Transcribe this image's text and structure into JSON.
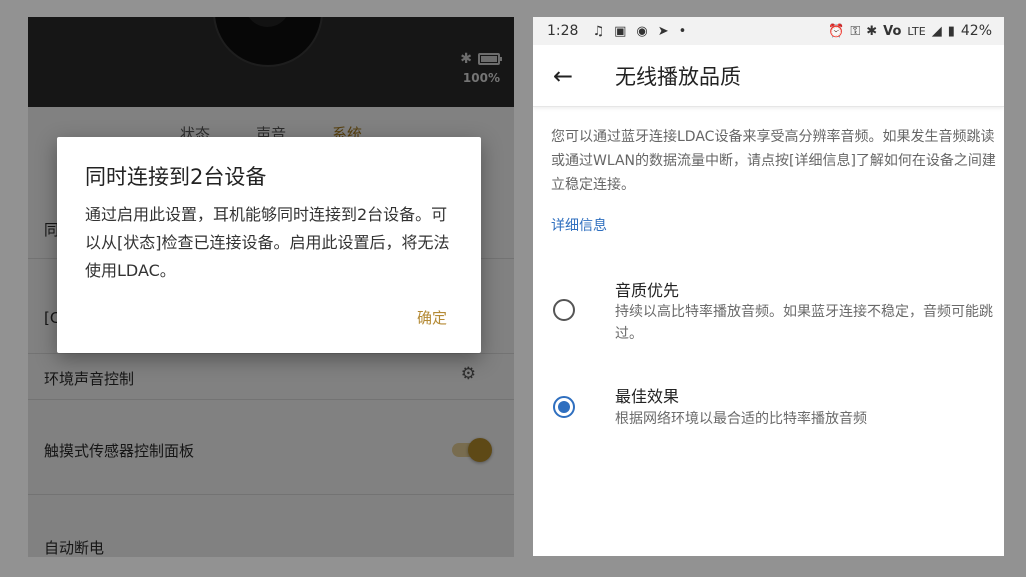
{
  "left": {
    "battery_percent": "100%",
    "tabs": [
      {
        "label": "状态",
        "active": false
      },
      {
        "label": "声音",
        "active": false
      },
      {
        "label": "系统",
        "active": true
      }
    ],
    "rows": [
      {
        "label": "同"
      },
      {
        "label": "[C"
      },
      {
        "label": "环境声音控制",
        "icon": "gear-icon"
      },
      {
        "label": "触摸式传感器控制面板",
        "toggle_on": true
      },
      {
        "label": "自动断电"
      }
    ],
    "dialog": {
      "title": "同时连接到2台设备",
      "body": "通过启用此设置，耳机能够同时连接到2台设备。可以从[状态]检查已连接设备。启用此设置后，将无法使用LDAC。",
      "ok_label": "确定"
    },
    "accent_color": "#b48a35"
  },
  "right": {
    "status_bar": {
      "time": "1:28",
      "left_icons": [
        "music-note-icon",
        "image-icon",
        "messenger-icon",
        "send-icon",
        "dot-icon"
      ],
      "right_icons": [
        "alarm-icon",
        "key-icon",
        "bluetooth-icon",
        "volte-icon",
        "signal-icon",
        "battery-icon"
      ],
      "volte_text": "Vo",
      "network_text": "LTE",
      "battery": "42%"
    },
    "app_bar": {
      "title": "无线播放品质"
    },
    "description": "您可以通过蓝牙连接LDAC设备来享受高分辨率音频。如果发生音频跳读或通过WLAN的数据流量中断，请点按[详细信息]了解如何在设备之间建立稳定连接。",
    "details_link": "详细信息",
    "options": [
      {
        "title": "音质优先",
        "subtitle": "持续以高比特率播放音频。如果蓝牙连接不稳定，音频可能跳过。",
        "selected": false
      },
      {
        "title": "最佳效果",
        "subtitle": "根据网络环境以最合适的比特率播放音频",
        "selected": true
      }
    ],
    "accent_color": "#2f6fbf"
  }
}
